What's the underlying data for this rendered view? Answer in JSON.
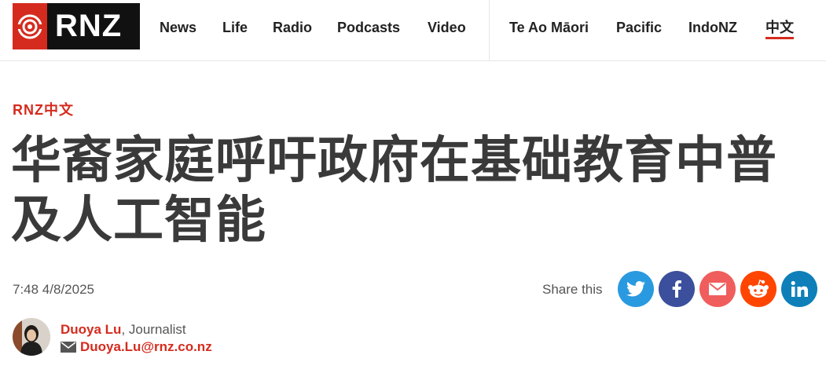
{
  "brand": {
    "logo_text": "RNZ",
    "accent": "#d52b1e"
  },
  "nav": {
    "primary": [
      "News",
      "Life",
      "Radio",
      "Podcasts",
      "Video"
    ],
    "secondary": [
      "Te Ao Māori",
      "Pacific",
      "IndoNZ",
      "中文"
    ],
    "active": "中文"
  },
  "article": {
    "section": "RNZ中文",
    "title": "华裔家庭呼吁政府在基础教育中普及人工智能",
    "timestamp": "7:48 4/8/2025"
  },
  "share": {
    "label": "Share this",
    "buttons": [
      {
        "icon": "twitter-icon",
        "color": "#2a9ae0"
      },
      {
        "icon": "facebook-icon",
        "color": "#3b4f9c"
      },
      {
        "icon": "email-icon",
        "color": "#f05d5d"
      },
      {
        "icon": "reddit-icon",
        "color": "#ff4500"
      },
      {
        "icon": "linkedin-icon",
        "color": "#0e7fb8"
      }
    ]
  },
  "author": {
    "name": "Duoya Lu",
    "role": ", Journalist",
    "email": "Duoya.Lu@rnz.co.nz"
  }
}
